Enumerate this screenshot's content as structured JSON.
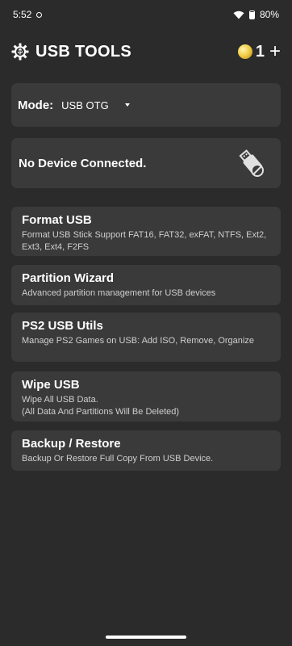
{
  "status_bar": {
    "time": "5:52",
    "battery": "80%"
  },
  "header": {
    "title": "USB TOOLS",
    "coin_count": "1",
    "add_symbol": "+"
  },
  "mode": {
    "label": "Mode:",
    "selected": "USB OTG"
  },
  "device": {
    "status": "No Device Connected."
  },
  "menu": [
    {
      "title": "Format USB",
      "description": "Format USB Stick Support FAT16, FAT32, exFAT, NTFS, Ext2, Ext3, Ext4, F2FS"
    },
    {
      "title": "Partition Wizard",
      "description": "Advanced partition management for USB devices"
    },
    {
      "title": "PS2 USB Utils",
      "description": "Manage PS2 Games on USB: Add ISO, Remove, Organize"
    },
    {
      "title": "Wipe USB",
      "description": "Wipe All USB Data.\n(All Data And Partitions Will Be Deleted)"
    },
    {
      "title": "Backup / Restore",
      "description": "Backup Or Restore Full Copy From USB Device."
    }
  ],
  "colors": {
    "background": "#2b2b2b",
    "card": "#3a3a3a",
    "coin": "#f3cf4a"
  }
}
